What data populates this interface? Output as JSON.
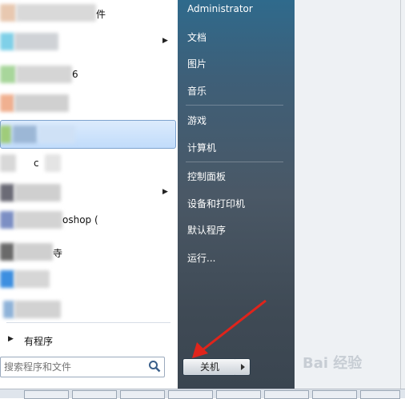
{
  "left": {
    "programs": [
      {
        "label": "件",
        "arrow": false
      },
      {
        "label": "",
        "arrow": true
      },
      {
        "label": "6",
        "arrow": false
      },
      {
        "label": "",
        "arrow": false
      },
      {
        "label": "",
        "arrow": false
      },
      {
        "label": "c",
        "arrow": false
      },
      {
        "label": "",
        "arrow": true
      },
      {
        "label": "oshop (",
        "arrow": false
      },
      {
        "label": "寺",
        "arrow": false
      },
      {
        "label": "",
        "arrow": false
      },
      {
        "label": "",
        "arrow": false
      }
    ],
    "all_programs": "有程序",
    "search_placeholder": "搜索程序和文件"
  },
  "right": {
    "user": "Administrator",
    "items": [
      "文档",
      "图片",
      "音乐",
      "游戏",
      "计算机",
      "控制面板",
      "设备和打印机",
      "默认程序",
      "运行..."
    ],
    "shutdown": "关机"
  },
  "watermark": "Bai 经验",
  "colors": {
    "highlight": "#c1dcfb",
    "pane": "#3e5f78",
    "arrow": "#e0241b"
  }
}
